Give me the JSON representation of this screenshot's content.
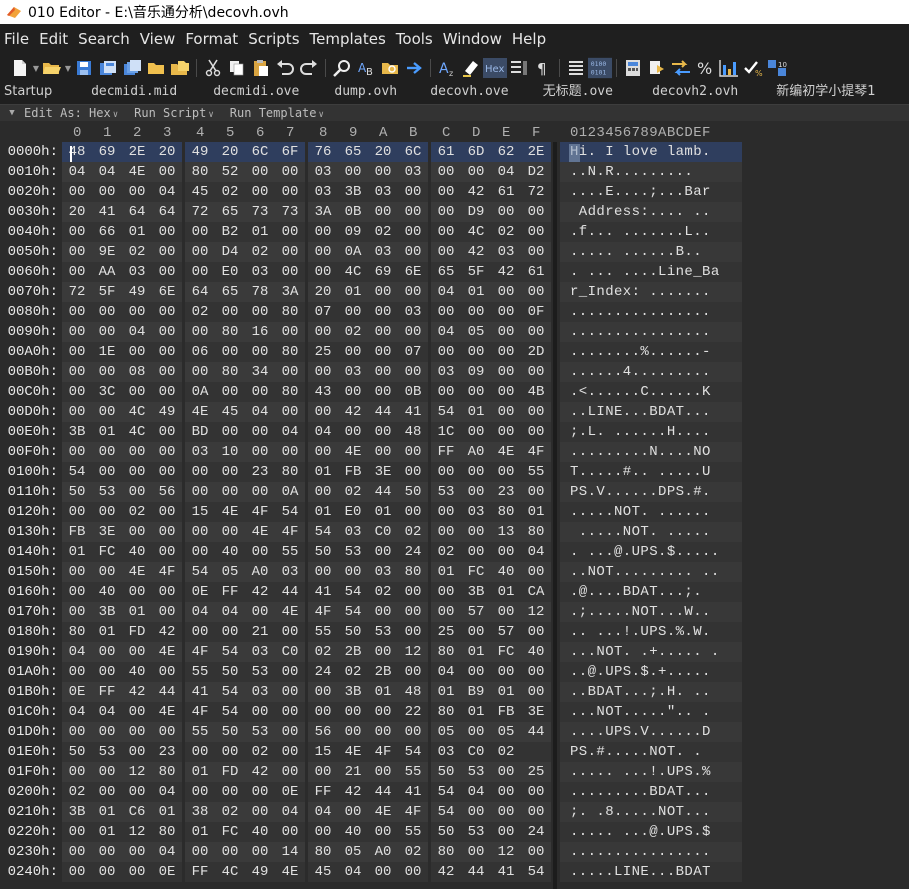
{
  "window": {
    "title": "010 Editor - E:\\音乐通分析\\decovh.ovh"
  },
  "menu": [
    {
      "label": "File"
    },
    {
      "label": "Edit"
    },
    {
      "label": "Search"
    },
    {
      "label": "View"
    },
    {
      "label": "Format"
    },
    {
      "label": "Scripts"
    },
    {
      "label": "Templates"
    },
    {
      "label": "Tools"
    },
    {
      "label": "Window"
    },
    {
      "label": "Help"
    }
  ],
  "toolbar": {
    "icons": [
      "new-file-icon",
      "open-folder-icon",
      "save-icon",
      "save-as-icon",
      "save-all-icon",
      "open-folder-2-icon",
      "open-workspace-icon",
      "cut-icon",
      "copy-icon",
      "paste-icon",
      "undo-icon",
      "redo-icon",
      "find-icon",
      "replace-icon",
      "find-in-files-icon",
      "goto-icon",
      "font-icon",
      "highlight-icon",
      "hex-mode-icon",
      "columns-icon",
      "paragraph-icon",
      "list-icon",
      "binary-mode-icon",
      "calculator-icon",
      "bookmark-icon",
      "compare-icon",
      "percent-icon",
      "histogram-icon",
      "checksum-icon",
      "hex-operations-icon"
    ],
    "hex_label": "Hex",
    "binary_label": "0100 0101"
  },
  "tabs": [
    {
      "label": "Startup"
    },
    {
      "label": "decmidi.mid"
    },
    {
      "label": "decmidi.ove"
    },
    {
      "label": "dump.ovh"
    },
    {
      "label": "decovh.ove"
    },
    {
      "label": "无标题.ove"
    },
    {
      "label": "decovh2.ovh"
    },
    {
      "label": "新编初学小提琴1"
    }
  ],
  "editbar": {
    "edit_as": "Edit As: Hex",
    "run_script": "Run Script",
    "run_template": "Run Template"
  },
  "columns": [
    "0",
    "1",
    "2",
    "3",
    "4",
    "5",
    "6",
    "7",
    "8",
    "9",
    "A",
    "B",
    "C",
    "D",
    "E",
    "F"
  ],
  "ascii_header": "0123456789ABCDEF",
  "rows": [
    {
      "addr": "0000h:",
      "hex": [
        "48",
        "69",
        "2E",
        "20",
        "49",
        "20",
        "6C",
        "6F",
        "76",
        "65",
        "20",
        "6C",
        "61",
        "6D",
        "62",
        "2E"
      ],
      "ascii": "Hi. I love lamb."
    },
    {
      "addr": "0010h:",
      "hex": [
        "04",
        "04",
        "4E",
        "00",
        "80",
        "52",
        "00",
        "00",
        "03",
        "00",
        "00",
        "03",
        "00",
        "00",
        "04",
        "D2"
      ],
      "ascii": "..N.R........."
    },
    {
      "addr": "0020h:",
      "hex": [
        "00",
        "00",
        "00",
        "04",
        "45",
        "02",
        "00",
        "00",
        "03",
        "3B",
        "03",
        "00",
        "00",
        "42",
        "61",
        "72"
      ],
      "ascii": "....E....;...Bar"
    },
    {
      "addr": "0030h:",
      "hex": [
        "20",
        "41",
        "64",
        "64",
        "72",
        "65",
        "73",
        "73",
        "3A",
        "0B",
        "00",
        "00",
        "00",
        "D9",
        "00",
        "00"
      ],
      "ascii": " Address:.... .."
    },
    {
      "addr": "0040h:",
      "hex": [
        "00",
        "66",
        "01",
        "00",
        "00",
        "B2",
        "01",
        "00",
        "00",
        "09",
        "02",
        "00",
        "00",
        "4C",
        "02",
        "00"
      ],
      "ascii": ".f... .......L.."
    },
    {
      "addr": "0050h:",
      "hex": [
        "00",
        "9E",
        "02",
        "00",
        "00",
        "D4",
        "02",
        "00",
        "00",
        "0A",
        "03",
        "00",
        "00",
        "42",
        "03",
        "00"
      ],
      "ascii": "..... ......B.."
    },
    {
      "addr": "0060h:",
      "hex": [
        "00",
        "AA",
        "03",
        "00",
        "00",
        "E0",
        "03",
        "00",
        "00",
        "4C",
        "69",
        "6E",
        "65",
        "5F",
        "42",
        "61"
      ],
      "ascii": ". ... ....Line_Ba"
    },
    {
      "addr": "0070h:",
      "hex": [
        "72",
        "5F",
        "49",
        "6E",
        "64",
        "65",
        "78",
        "3A",
        "20",
        "01",
        "00",
        "00",
        "04",
        "01",
        "00",
        "00"
      ],
      "ascii": "r_Index: ......."
    },
    {
      "addr": "0080h:",
      "hex": [
        "00",
        "00",
        "00",
        "00",
        "02",
        "00",
        "00",
        "80",
        "07",
        "00",
        "00",
        "03",
        "00",
        "00",
        "00",
        "0F"
      ],
      "ascii": "................"
    },
    {
      "addr": "0090h:",
      "hex": [
        "00",
        "00",
        "04",
        "00",
        "00",
        "80",
        "16",
        "00",
        "00",
        "02",
        "00",
        "00",
        "04",
        "05",
        "00",
        "00"
      ],
      "ascii": "................"
    },
    {
      "addr": "00A0h:",
      "hex": [
        "00",
        "1E",
        "00",
        "00",
        "06",
        "00",
        "00",
        "80",
        "25",
        "00",
        "00",
        "07",
        "00",
        "00",
        "00",
        "2D"
      ],
      "ascii": "........%......-"
    },
    {
      "addr": "00B0h:",
      "hex": [
        "00",
        "00",
        "08",
        "00",
        "00",
        "80",
        "34",
        "00",
        "00",
        "03",
        "00",
        "00",
        "03",
        "09",
        "00",
        "00"
      ],
      "ascii": "......4........."
    },
    {
      "addr": "00C0h:",
      "hex": [
        "00",
        "3C",
        "00",
        "00",
        "0A",
        "00",
        "00",
        "80",
        "43",
        "00",
        "00",
        "0B",
        "00",
        "00",
        "00",
        "4B"
      ],
      "ascii": ".<......C......K"
    },
    {
      "addr": "00D0h:",
      "hex": [
        "00",
        "00",
        "4C",
        "49",
        "4E",
        "45",
        "04",
        "00",
        "00",
        "42",
        "44",
        "41",
        "54",
        "01",
        "00",
        "00"
      ],
      "ascii": "..LINE...BDAT..."
    },
    {
      "addr": "00E0h:",
      "hex": [
        "3B",
        "01",
        "4C",
        "00",
        "BD",
        "00",
        "00",
        "04",
        "04",
        "00",
        "00",
        "48",
        "1C",
        "00",
        "00",
        "00"
      ],
      "ascii": ";.L. ......H...."
    },
    {
      "addr": "00F0h:",
      "hex": [
        "00",
        "00",
        "00",
        "00",
        "03",
        "10",
        "00",
        "00",
        "00",
        "4E",
        "00",
        "00",
        "FF",
        "A0",
        "4E",
        "4F"
      ],
      "ascii": ".........N....NO"
    },
    {
      "addr": "0100h:",
      "hex": [
        "54",
        "00",
        "00",
        "00",
        "00",
        "00",
        "23",
        "80",
        "01",
        "FB",
        "3E",
        "00",
        "00",
        "00",
        "00",
        "55"
      ],
      "ascii": "T.....#.. .....U"
    },
    {
      "addr": "0110h:",
      "hex": [
        "50",
        "53",
        "00",
        "56",
        "00",
        "00",
        "00",
        "0A",
        "00",
        "02",
        "44",
        "50",
        "53",
        "00",
        "23",
        "00"
      ],
      "ascii": "PS.V......DPS.#."
    },
    {
      "addr": "0120h:",
      "hex": [
        "00",
        "00",
        "02",
        "00",
        "15",
        "4E",
        "4F",
        "54",
        "01",
        "E0",
        "01",
        "00",
        "00",
        "03",
        "80",
        "01"
      ],
      "ascii": ".....NOT. ......"
    },
    {
      "addr": "0130h:",
      "hex": [
        "FB",
        "3E",
        "00",
        "00",
        "00",
        "00",
        "4E",
        "4F",
        "54",
        "03",
        "C0",
        "02",
        "00",
        "00",
        "13",
        "80"
      ],
      "ascii": " .....NOT. ....."
    },
    {
      "addr": "0140h:",
      "hex": [
        "01",
        "FC",
        "40",
        "00",
        "00",
        "40",
        "00",
        "55",
        "50",
        "53",
        "00",
        "24",
        "02",
        "00",
        "00",
        "04"
      ],
      "ascii": ". ...@.UPS.$....."
    },
    {
      "addr": "0150h:",
      "hex": [
        "00",
        "00",
        "4E",
        "4F",
        "54",
        "05",
        "A0",
        "03",
        "00",
        "00",
        "03",
        "80",
        "01",
        "FC",
        "40",
        "00"
      ],
      "ascii": "..NOT......... .."
    },
    {
      "addr": "0160h:",
      "hex": [
        "00",
        "40",
        "00",
        "00",
        "0E",
        "FF",
        "42",
        "44",
        "41",
        "54",
        "02",
        "00",
        "00",
        "3B",
        "01",
        "CA"
      ],
      "ascii": ".@....BDAT...;. "
    },
    {
      "addr": "0170h:",
      "hex": [
        "00",
        "3B",
        "01",
        "00",
        "04",
        "04",
        "00",
        "4E",
        "4F",
        "54",
        "00",
        "00",
        "00",
        "57",
        "00",
        "12"
      ],
      "ascii": ".;.....NOT...W.."
    },
    {
      "addr": "0180h:",
      "hex": [
        "80",
        "01",
        "FD",
        "42",
        "00",
        "00",
        "21",
        "00",
        "55",
        "50",
        "53",
        "00",
        "25",
        "00",
        "57",
        "00"
      ],
      "ascii": ".. ...!.UPS.%.W."
    },
    {
      "addr": "0190h:",
      "hex": [
        "04",
        "00",
        "00",
        "4E",
        "4F",
        "54",
        "03",
        "C0",
        "02",
        "2B",
        "00",
        "12",
        "80",
        "01",
        "FC",
        "40"
      ],
      "ascii": "...NOT. .+..... ."
    },
    {
      "addr": "01A0h:",
      "hex": [
        "00",
        "00",
        "40",
        "00",
        "55",
        "50",
        "53",
        "00",
        "24",
        "02",
        "2B",
        "00",
        "04",
        "00",
        "00",
        "00"
      ],
      "ascii": "..@.UPS.$.+....."
    },
    {
      "addr": "01B0h:",
      "hex": [
        "0E",
        "FF",
        "42",
        "44",
        "41",
        "54",
        "03",
        "00",
        "00",
        "3B",
        "01",
        "48",
        "01",
        "B9",
        "01",
        "00"
      ],
      "ascii": "..BDAT...;.H. .."
    },
    {
      "addr": "01C0h:",
      "hex": [
        "04",
        "04",
        "00",
        "4E",
        "4F",
        "54",
        "00",
        "00",
        "00",
        "00",
        "00",
        "22",
        "80",
        "01",
        "FB",
        "3E"
      ],
      "ascii": "...NOT.....\".. ."
    },
    {
      "addr": "01D0h:",
      "hex": [
        "00",
        "00",
        "00",
        "00",
        "55",
        "50",
        "53",
        "00",
        "56",
        "00",
        "00",
        "00",
        "05",
        "00",
        "05",
        "44"
      ],
      "ascii": "....UPS.V......D"
    },
    {
      "addr": "01E0h:",
      "hex": [
        "50",
        "53",
        "00",
        "23",
        "00",
        "00",
        "02",
        "00",
        "15",
        "4E",
        "4F",
        "54",
        "03",
        "C0",
        "02"
      ],
      "ascii": "PS.#.....NOT. ."
    },
    {
      "addr": "01F0h:",
      "hex": [
        "00",
        "00",
        "12",
        "80",
        "01",
        "FD",
        "42",
        "00",
        "00",
        "21",
        "00",
        "55",
        "50",
        "53",
        "00",
        "25"
      ],
      "ascii": "..... ...!.UPS.%"
    },
    {
      "addr": "0200h:",
      "hex": [
        "02",
        "00",
        "00",
        "04",
        "00",
        "00",
        "00",
        "0E",
        "FF",
        "42",
        "44",
        "41",
        "54",
        "04",
        "00",
        "00"
      ],
      "ascii": ".........BDAT..."
    },
    {
      "addr": "0210h:",
      "hex": [
        "3B",
        "01",
        "C6",
        "01",
        "38",
        "02",
        "00",
        "04",
        "04",
        "00",
        "4E",
        "4F",
        "54",
        "00",
        "00",
        "00"
      ],
      "ascii": ";. .8.....NOT..."
    },
    {
      "addr": "0220h:",
      "hex": [
        "00",
        "01",
        "12",
        "80",
        "01",
        "FC",
        "40",
        "00",
        "00",
        "40",
        "00",
        "55",
        "50",
        "53",
        "00",
        "24"
      ],
      "ascii": "..... ...@.UPS.$"
    },
    {
      "addr": "0230h:",
      "hex": [
        "00",
        "00",
        "00",
        "04",
        "00",
        "00",
        "00",
        "14",
        "80",
        "05",
        "A0",
        "02",
        "80",
        "00",
        "12",
        "00"
      ],
      "ascii": "................"
    },
    {
      "addr": "0240h:",
      "hex": [
        "00",
        "00",
        "00",
        "0E",
        "FF",
        "4C",
        "49",
        "4E",
        "45",
        "04",
        "00",
        "00",
        "42",
        "44",
        "41",
        "54"
      ],
      "ascii": ".....LINE...BDAT"
    }
  ]
}
